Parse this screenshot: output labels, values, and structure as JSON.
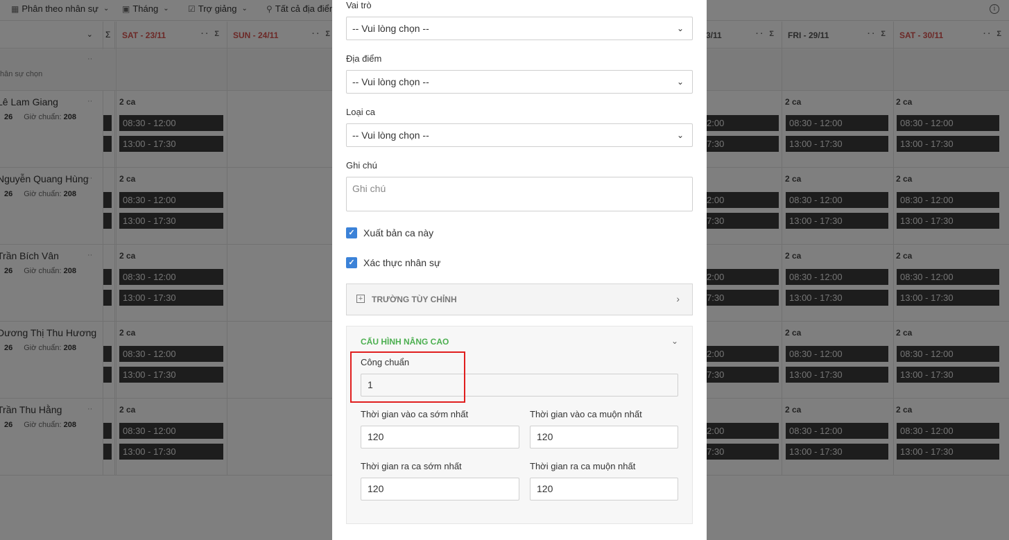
{
  "toolbar": {
    "items": [
      {
        "label": "Phân theo nhân sự",
        "icon": "people-icon"
      },
      {
        "label": "Tháng",
        "icon": "calendar-icon"
      },
      {
        "label": "Trợ giảng",
        "icon": "checkbox-icon"
      },
      {
        "label": "Tất cả địa điểm",
        "icon": "location-icon"
      }
    ]
  },
  "schedule": {
    "sigma": "Σ",
    "days_left": [
      {
        "label": "SAT - 23/11",
        "weekend": true
      },
      {
        "label": "SUN - 24/11",
        "weekend": true
      }
    ],
    "days_right": [
      {
        "label": "3/11",
        "weekend": false
      },
      {
        "label": "FRI - 29/11",
        "weekend": false
      },
      {
        "label": "SAT - 30/11",
        "weekend": true
      }
    ],
    "filter_text": "hân sự chọn",
    "employees": [
      {
        "name": "Lê Lam Giang",
        "count": "26",
        "std_label": "Giờ chuẩn:",
        "std_value": "208"
      },
      {
        "name": "Nguyễn Quang Hùng",
        "count": "26",
        "std_label": "Giờ chuẩn:",
        "std_value": "208"
      },
      {
        "name": "Trần Bích Vân",
        "count": "26",
        "std_label": "Giờ chuẩn:",
        "std_value": "208"
      },
      {
        "name": "Dương Thị Thu Hương",
        "count": "26",
        "std_label": "Giờ chuẩn:",
        "std_value": "208"
      },
      {
        "name": "Trần Thu Hằng",
        "count": "26",
        "std_label": "Giờ chuẩn:",
        "std_value": "208"
      }
    ],
    "cell_count_label": "2 ca",
    "shift_morning": "08:30 - 12:00",
    "shift_afternoon": "13:00 - 17:30",
    "shift_morning_partial": "2:00",
    "shift_afternoon_partial": "7:30"
  },
  "modal": {
    "role_label": "Vai trò",
    "role_value": "-- Vui lòng chọn --",
    "location_label": "Địa điểm",
    "location_value": "-- Vui lòng chọn --",
    "shift_type_label": "Loại ca",
    "shift_type_value": "-- Vui lòng chọn --",
    "note_label": "Ghi chú",
    "note_placeholder": "Ghi chú",
    "publish_label": "Xuất bản ca này",
    "verify_label": "Xác thực nhân sự",
    "custom_fields_title": "TRƯỜNG TÙY CHỈNH",
    "advanced_title": "CẤU HÌNH NÂNG CAO",
    "standard_work_label": "Công chuẩn",
    "standard_work_value": "1",
    "earliest_in_label": "Thời gian vào ca sớm nhất",
    "earliest_in_value": "120",
    "latest_in_label": "Thời gian vào ca muộn nhất",
    "latest_in_value": "120",
    "earliest_out_label": "Thời gian ra ca sớm nhất",
    "earliest_out_value": "120",
    "latest_out_label": "Thời gian ra ca muộn nhất",
    "latest_out_value": "120"
  },
  "colors": {
    "accent_green": "#4caf50",
    "checkbox_blue": "#3b82d8",
    "highlight_red": "#e01e1e",
    "weekend_red": "#d9534f"
  }
}
